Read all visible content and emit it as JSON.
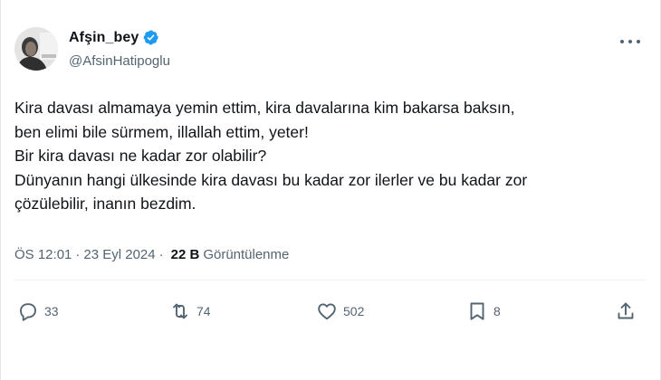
{
  "user": {
    "display_name": "Afşin_bey",
    "handle": "@AfsinHatipoglu",
    "verified_color": "#1d9bf0"
  },
  "tweet": {
    "text": "Kira davası almamaya yemin ettim, kira davalarına kim bakarsa baksın,\nben elimi bile sürmem, illallah ettim, yeter!\nBir kira davası ne kadar zor olabilir?\nDünyanın hangi ülkesinde kira davası bu kadar zor ilerler ve bu kadar zor\nçözülebilir, inanın bezdim.",
    "time": "ÖS 12:01",
    "separator": "·",
    "date": "23 Eyl 2024",
    "views_count": "22 B",
    "views_label": "Görüntülenme"
  },
  "actions": {
    "replies": "33",
    "retweets": "74",
    "likes": "502",
    "bookmarks": "8"
  },
  "icons": [
    "verified-badge-icon",
    "more-options-icon",
    "reply-icon",
    "retweet-icon",
    "like-icon",
    "bookmark-icon",
    "share-icon"
  ]
}
